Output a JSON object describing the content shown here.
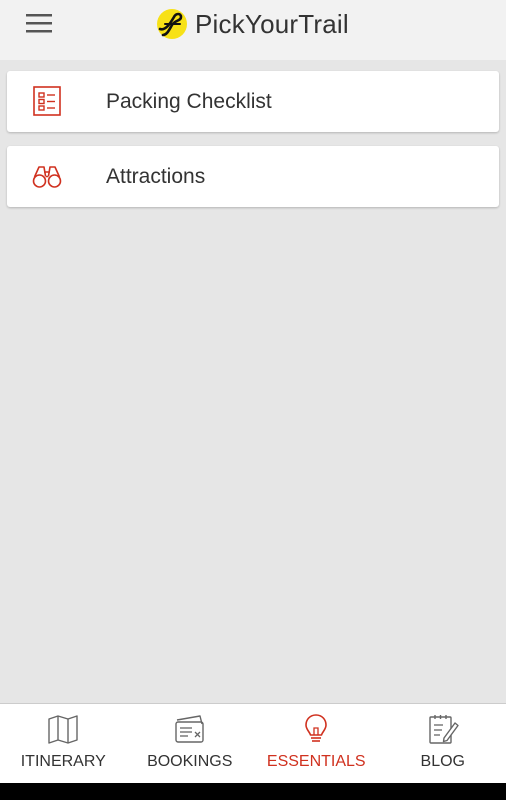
{
  "header": {
    "menu_icon": "hamburger-menu-icon",
    "logo_icon": "pickyourtrail-logo-icon",
    "app_name": "PickYourTrail"
  },
  "essentials": {
    "items": [
      {
        "label": "Packing Checklist",
        "icon": "checklist-icon"
      },
      {
        "label": "Attractions",
        "icon": "binoculars-icon"
      }
    ]
  },
  "tabs": {
    "items": [
      {
        "label": "ITINERARY",
        "icon": "map-icon",
        "active": false
      },
      {
        "label": "BOOKINGS",
        "icon": "ticket-icon",
        "active": false
      },
      {
        "label": "ESSENTIALS",
        "icon": "lightbulb-icon",
        "active": true
      },
      {
        "label": "BLOG",
        "icon": "notepad-pen-icon",
        "active": false
      }
    ]
  },
  "colors": {
    "accent": "#d0311f",
    "logo_yellow": "#f7e117",
    "background": "#e6e6e6",
    "header_background": "#f2f2f2",
    "text": "#333333"
  }
}
